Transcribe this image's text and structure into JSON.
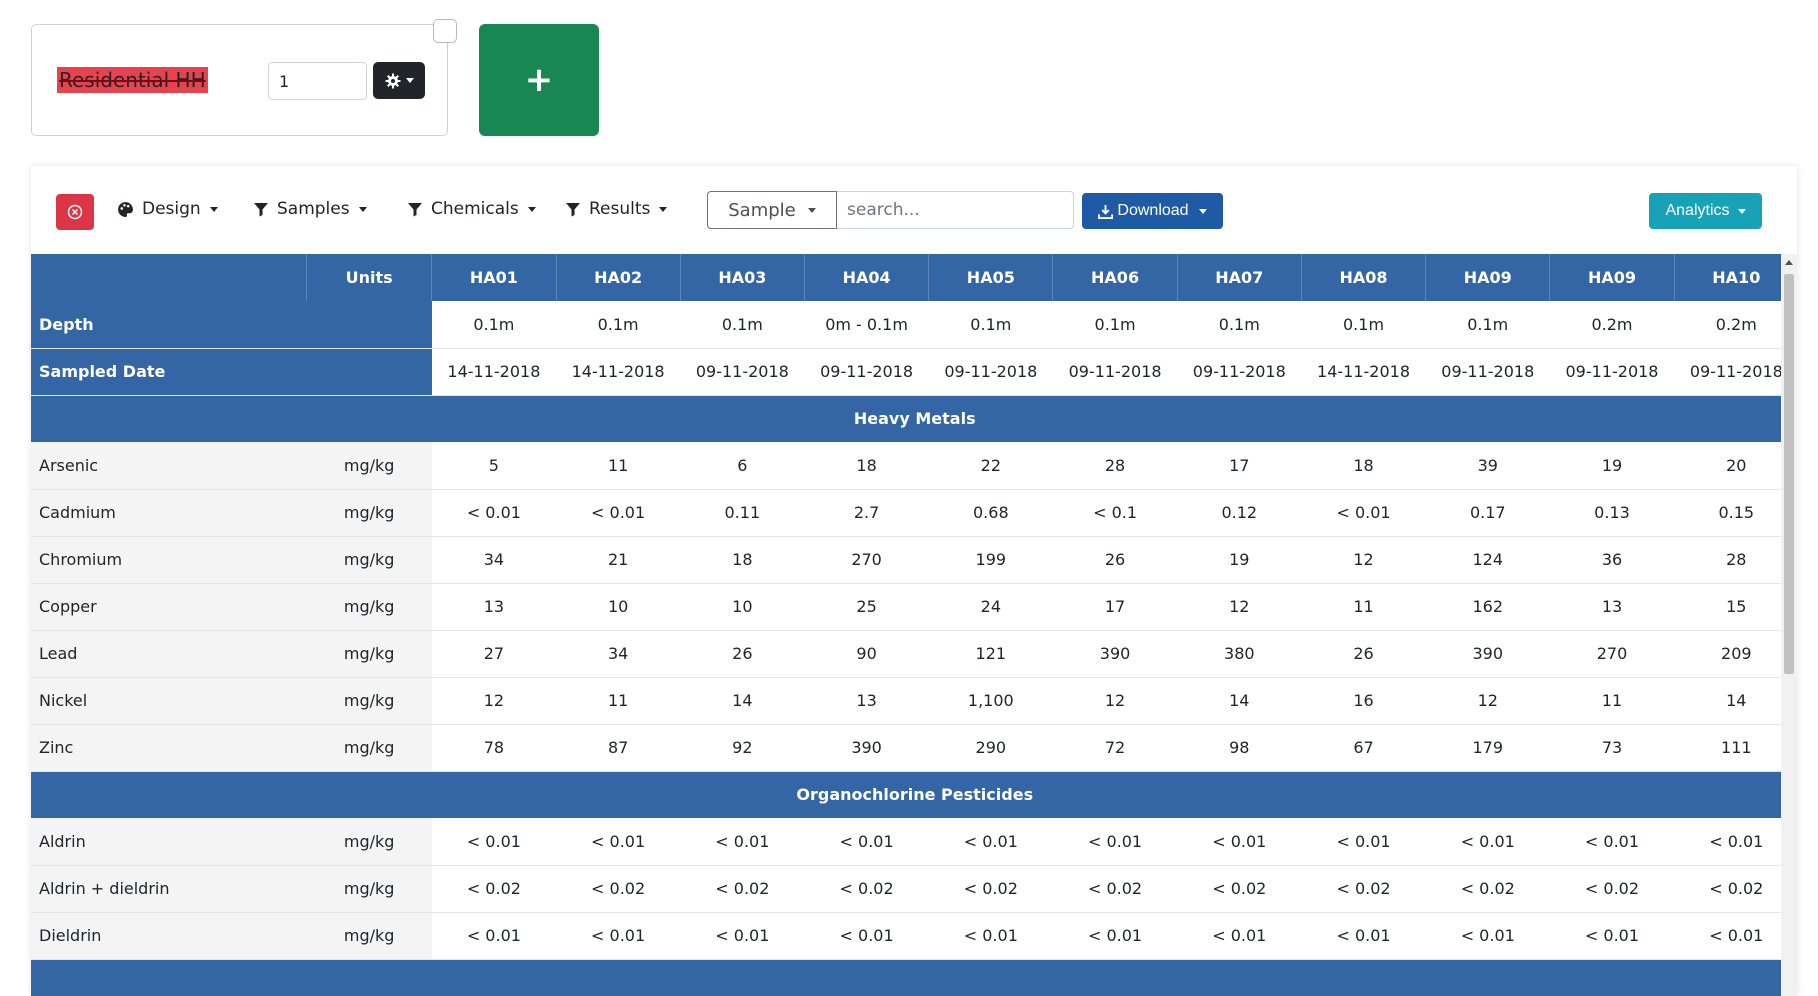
{
  "criteria": {
    "name": "Residential HH",
    "quantity": "1"
  },
  "add_button": {
    "label": "+"
  },
  "toolbar": {
    "design_label": "Design",
    "samples_label": "Samples",
    "chemicals_label": "Chemicals",
    "results_label": "Results",
    "sample_select_value": "Sample",
    "search_placeholder": "search...",
    "download_label": "Download",
    "analytics_label": "Analytics"
  },
  "table": {
    "units_header": "Units",
    "samples": [
      "HA01",
      "HA02",
      "HA03",
      "HA04",
      "HA05",
      "HA06",
      "HA07",
      "HA08",
      "HA09",
      "HA09",
      "HA10"
    ],
    "meta_rows": [
      {
        "label": "Depth",
        "values": [
          "0.1m",
          "0.1m",
          "0.1m",
          "0m - 0.1m",
          "0.1m",
          "0.1m",
          "0.1m",
          "0.1m",
          "0.1m",
          "0.2m",
          "0.2m"
        ]
      },
      {
        "label": "Sampled Date",
        "values": [
          "14-11-2018",
          "14-11-2018",
          "09-11-2018",
          "09-11-2018",
          "09-11-2018",
          "09-11-2018",
          "09-11-2018",
          "14-11-2018",
          "09-11-2018",
          "09-11-2018",
          "09-11-2018"
        ]
      }
    ],
    "groups": [
      {
        "name": "Heavy Metals",
        "rows": [
          {
            "name": "Arsenic",
            "unit": "mg/kg",
            "values": [
              "5",
              "11",
              "6",
              "18",
              "22",
              "28",
              "17",
              "18",
              "39",
              "19",
              "20"
            ]
          },
          {
            "name": "Cadmium",
            "unit": "mg/kg",
            "values": [
              "< 0.01",
              "< 0.01",
              "0.11",
              "2.7",
              "0.68",
              "< 0.1",
              "0.12",
              "< 0.01",
              "0.17",
              "0.13",
              "0.15"
            ]
          },
          {
            "name": "Chromium",
            "unit": "mg/kg",
            "values": [
              "34",
              "21",
              "18",
              "270",
              "199",
              "26",
              "19",
              "12",
              "124",
              "36",
              "28"
            ]
          },
          {
            "name": "Copper",
            "unit": "mg/kg",
            "values": [
              "13",
              "10",
              "10",
              "25",
              "24",
              "17",
              "12",
              "11",
              "162",
              "13",
              "15"
            ]
          },
          {
            "name": "Lead",
            "unit": "mg/kg",
            "values": [
              "27",
              "34",
              "26",
              "90",
              "121",
              "390",
              "380",
              "26",
              "390",
              "270",
              "209"
            ]
          },
          {
            "name": "Nickel",
            "unit": "mg/kg",
            "values": [
              "12",
              "11",
              "14",
              "13",
              "1,100",
              "12",
              "14",
              "16",
              "12",
              "11",
              "14"
            ]
          },
          {
            "name": "Zinc",
            "unit": "mg/kg",
            "values": [
              "78",
              "87",
              "92",
              "390",
              "290",
              "72",
              "98",
              "67",
              "179",
              "73",
              "111"
            ]
          }
        ]
      },
      {
        "name": "Organochlorine Pesticides",
        "rows": [
          {
            "name": "Aldrin",
            "unit": "mg/kg",
            "values": [
              "< 0.01",
              "< 0.01",
              "< 0.01",
              "< 0.01",
              "< 0.01",
              "< 0.01",
              "< 0.01",
              "< 0.01",
              "< 0.01",
              "< 0.01",
              "< 0.01"
            ]
          },
          {
            "name": "Aldrin + dieldrin",
            "unit": "mg/kg",
            "values": [
              "< 0.02",
              "< 0.02",
              "< 0.02",
              "< 0.02",
              "< 0.02",
              "< 0.02",
              "< 0.02",
              "< 0.02",
              "< 0.02",
              "< 0.02",
              "< 0.02"
            ]
          },
          {
            "name": "Dieldrin",
            "unit": "mg/kg",
            "values": [
              "< 0.01",
              "< 0.01",
              "< 0.01",
              "< 0.01",
              "< 0.01",
              "< 0.01",
              "< 0.01",
              "< 0.01",
              "< 0.01",
              "< 0.01",
              "< 0.01"
            ]
          }
        ]
      }
    ]
  }
}
